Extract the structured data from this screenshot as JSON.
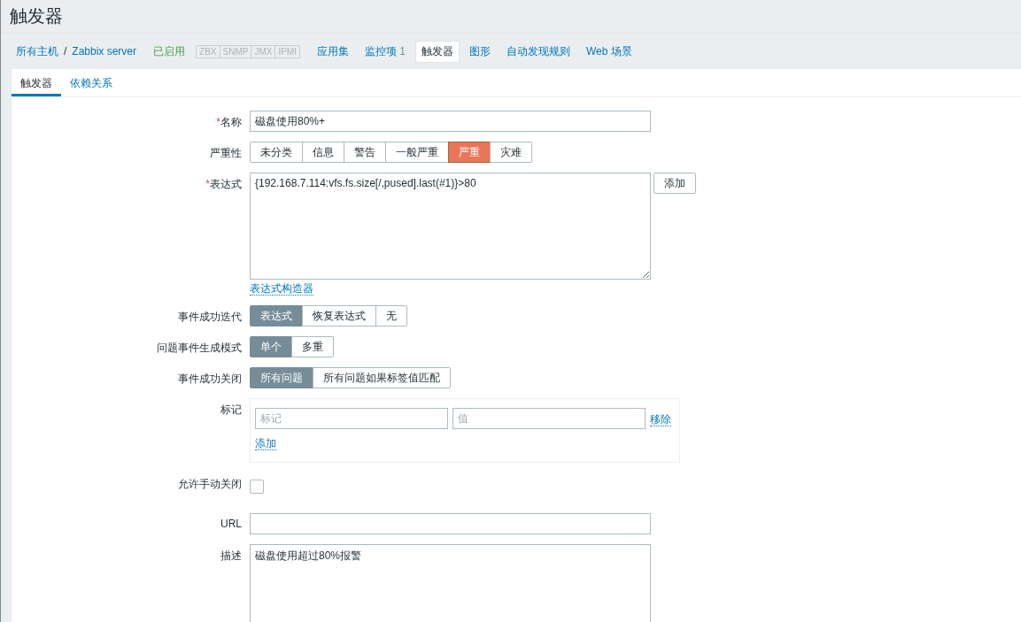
{
  "page_title": "触发器",
  "required_mark": "*",
  "breadcrumb": [
    {
      "label": "所有主机"
    },
    {
      "label": "Zabbix server"
    }
  ],
  "breadcrumb_separator": "/",
  "status": {
    "label": "已启用",
    "enabled": true
  },
  "availability": [
    {
      "label": "ZBX",
      "available": false
    },
    {
      "label": "SNMP",
      "available": false
    },
    {
      "label": "JMX",
      "available": false
    },
    {
      "label": "IPMI",
      "available": false
    }
  ],
  "nav": [
    {
      "label": "应用集",
      "selected": false
    },
    {
      "label": "监控项",
      "count": "1",
      "selected": false
    },
    {
      "label": "触发器",
      "selected": true
    },
    {
      "label": "图形",
      "selected": false
    },
    {
      "label": "自动发现规则",
      "selected": false
    },
    {
      "label": "Web 场景",
      "selected": false
    }
  ],
  "tabs": [
    {
      "label": "触发器",
      "selected": true
    },
    {
      "label": "依赖关系",
      "selected": false
    }
  ],
  "fields": [
    {
      "kind": "text",
      "label": "名称",
      "required": true,
      "value": "磁盘使用80%+"
    },
    {
      "kind": "severity",
      "label": "严重性",
      "required": false,
      "options": [
        {
          "label": "未分类",
          "selected": false
        },
        {
          "label": "信息",
          "selected": false
        },
        {
          "label": "警告",
          "selected": false
        },
        {
          "label": "一般严重",
          "selected": false
        },
        {
          "label": "严重",
          "selected": true
        },
        {
          "label": "灾难",
          "selected": false
        }
      ]
    },
    {
      "kind": "expression",
      "label": "表达式",
      "required": true,
      "value": "{192.168.7.114:vfs.fs.size[/,pused].last(#1)}>80",
      "button": "添加",
      "link": "表达式构造器"
    },
    {
      "kind": "segmented",
      "label": "事件成功迭代",
      "required": false,
      "options": [
        {
          "label": "表达式",
          "selected": true
        },
        {
          "label": "恢复表达式",
          "selected": false
        },
        {
          "label": "无",
          "selected": false
        }
      ]
    },
    {
      "kind": "segmented",
      "label": "问题事件生成模式",
      "required": false,
      "options": [
        {
          "label": "单个",
          "selected": true
        },
        {
          "label": "多重",
          "selected": false
        }
      ]
    },
    {
      "kind": "segmented",
      "label": "事件成功关闭",
      "required": false,
      "options": [
        {
          "label": "所有问题",
          "selected": true
        },
        {
          "label": "所有问题如果标签值匹配",
          "selected": false
        }
      ]
    },
    {
      "kind": "tags",
      "label": "标记",
      "required": false,
      "tag_placeholder": "标记",
      "value_placeholder": "值",
      "remove": "移除",
      "add": "添加"
    },
    {
      "kind": "checkbox",
      "label": "允许手动关闭",
      "required": false,
      "checked": false
    },
    {
      "kind": "text",
      "label": "URL",
      "required": false
    },
    {
      "kind": "textarea",
      "label": "描述",
      "required": false,
      "value": "磁盘使用超过80%报警"
    }
  ]
}
